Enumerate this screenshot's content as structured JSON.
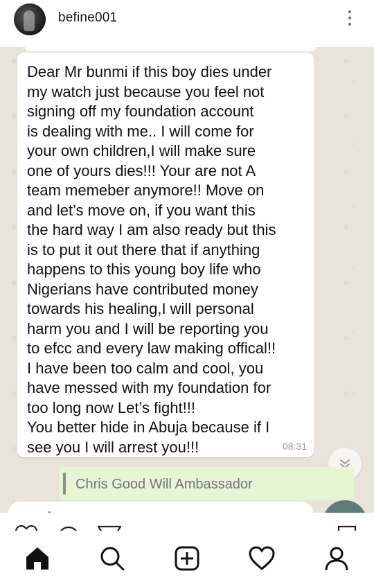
{
  "post": {
    "username": "befine001"
  },
  "chat": {
    "message": "Dear Mr bunmi if this boy dies under\nmy watch just because you feel not\nsigning off my foundation account\nis dealing with me.. I will come for\nyour own children,I will make sure\none of yours dies!!! Your are not A\nteam memeber anymore!! Move on\nand let’s move on, if you want this\nthe hard way I am also ready but this\nis to put it out there that if anything\nhappens to this young boy life who\nNigerians have contributed money\ntowards his healing,I will personal\nharm you and I will be reporting you\nto efcc and every law making offical!!\nI have been too calm and cool, you\nhave messed with my foundation for\ntoo long now Let’s fight!!!\nYou better hide in Abuja because if I\nsee you I will arrest you!!!",
    "time": "08:31",
    "reply_quote_name": "Chris Good Will Ambassador"
  },
  "icons": {
    "more": "more-vertical-icon",
    "scroll": "chevron-double-down-icon",
    "nav": [
      "home-icon",
      "search-icon",
      "new-post-icon",
      "activity-heart-icon",
      "profile-icon"
    ]
  },
  "colors": {
    "chat_background": "#e9e3d9",
    "bubble": "#ffffff",
    "quote_background": "#e6f6d4",
    "quote_name": "#7a6f88",
    "fab": "#5d7b78"
  }
}
